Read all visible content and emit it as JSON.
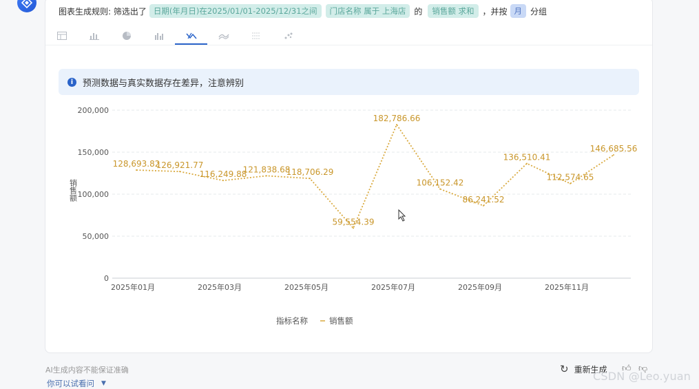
{
  "header": {
    "rule_prefix": "图表生成规则: 筛选出了",
    "filter_date": "日期(年月日)在2025/01/01-2025/12/31之间",
    "filter_store": "门店名称 属于 上海店",
    "of": "的",
    "metric": "销售额 求和",
    "group_by": "，并按",
    "group_unit": "月",
    "group_suffix": "分组"
  },
  "tabs": [
    {
      "name": "table",
      "icon": "table-icon"
    },
    {
      "name": "bar",
      "icon": "bar-chart-icon"
    },
    {
      "name": "pie",
      "icon": "pie-chart-icon"
    },
    {
      "name": "grouped-bar",
      "icon": "grouped-bar-icon"
    },
    {
      "name": "forecast-line",
      "icon": "forecast-line-icon",
      "active": true
    },
    {
      "name": "area",
      "icon": "area-chart-icon"
    },
    {
      "name": "stacked",
      "icon": "stacked-chart-icon"
    },
    {
      "name": "scatter",
      "icon": "scatter-chart-icon"
    }
  ],
  "notice": {
    "text": "预测数据与真实数据存在差异，注意辨别",
    "icon": "info-icon"
  },
  "chart_data": {
    "type": "line",
    "ylabel": "销售额",
    "ylim": [
      0,
      200000
    ],
    "yticks": [
      "0",
      "50,000",
      "100,000",
      "150,000",
      "200,000"
    ],
    "xtick_labels": [
      "2025年01月",
      "2025年03月",
      "2025年05月",
      "2025年07月",
      "2025年09月",
      "2025年11月"
    ],
    "categories": [
      "2025-01",
      "2025-02",
      "2025-03",
      "2025-04",
      "2025-05",
      "2025-06",
      "2025-07",
      "2025-08",
      "2025-09",
      "2025-10",
      "2025-11",
      "2025-12"
    ],
    "series": [
      {
        "name": "销售额",
        "values": [
          128693.82,
          126921.77,
          116249.88,
          121838.68,
          118706.29,
          59554.39,
          182786.66,
          106152.42,
          86241.52,
          136510.41,
          112574.65,
          146685.56
        ],
        "labels": [
          "128,693.82",
          "126,921.77",
          "116,249.88",
          "121,838.68",
          "118,706.29",
          "59,554.39",
          "182,786.66",
          "106,152.42",
          "86,241.52",
          "136,510.41",
          "112,574.65",
          "146,685.56"
        ],
        "color": "#d9a93e",
        "style": "dotted"
      }
    ],
    "legend_title": "指标名称",
    "legend_position": "bottom-center",
    "grid": true
  },
  "footer": {
    "disclaimer": "AI生成内容不能保证准确",
    "try_ask": "你可以试看问",
    "regenerate": "重新生成",
    "thumb_up_icon": "thumbs-up-icon",
    "thumb_down_icon": "thumbs-down-icon",
    "watermark": "CSDN @Leo.yuan"
  }
}
